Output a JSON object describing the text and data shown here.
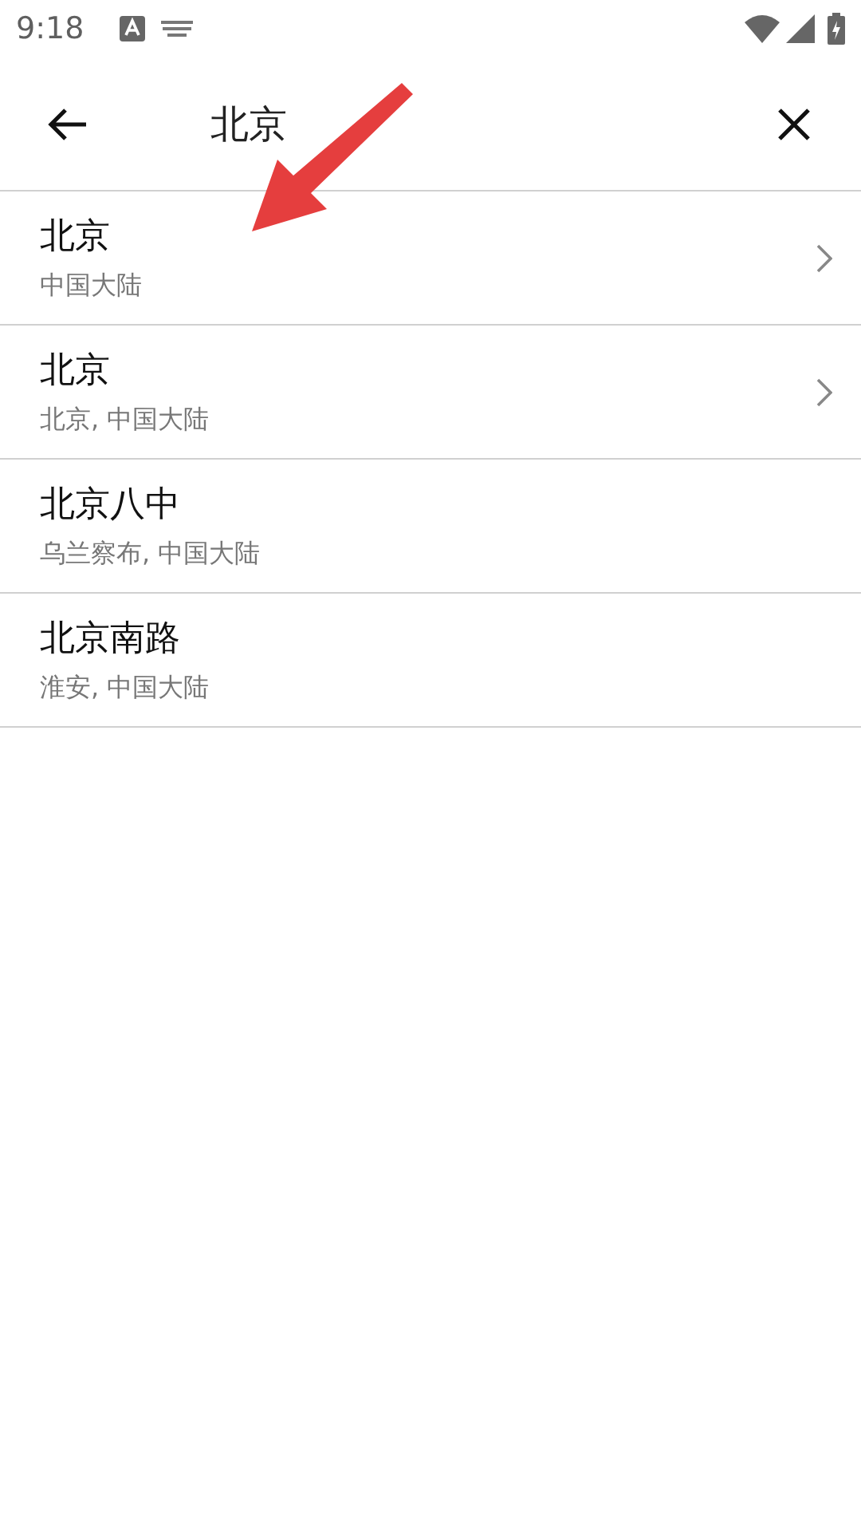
{
  "status_bar": {
    "time": "9:18"
  },
  "search": {
    "value": "北京"
  },
  "results": [
    {
      "name": "北京",
      "region": "中国大陆",
      "has_children": true
    },
    {
      "name": "北京",
      "region": "北京, 中国大陆",
      "has_children": true
    },
    {
      "name": "北京八中",
      "region": "乌兰察布, 中国大陆",
      "has_children": false
    },
    {
      "name": "北京南路",
      "region": "淮安, 中国大陆",
      "has_children": false
    }
  ]
}
